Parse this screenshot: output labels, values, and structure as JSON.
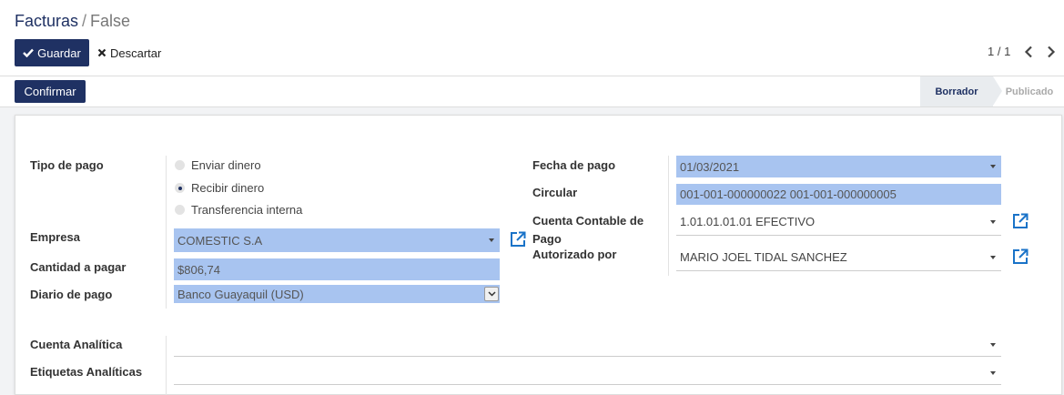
{
  "breadcrumb": {
    "parent": "Facturas",
    "separator": "/",
    "current": "False"
  },
  "toolbar": {
    "save_label": "Guardar",
    "discard_label": "Descartar"
  },
  "pager": {
    "value": "1 / 1"
  },
  "statusbar": {
    "confirm_label": "Confirmar",
    "stages": [
      "Borrador",
      "Publicado"
    ],
    "active_stage": "Borrador"
  },
  "form": {
    "payment_type_label": "Tipo de pago",
    "payment_type_options": [
      "Enviar dinero",
      "Recibir dinero",
      "Transferencia interna"
    ],
    "payment_type_selected": "Recibir dinero",
    "partner_label": "Empresa",
    "partner_value": "COMESTIC S.A",
    "amount_label": "Cantidad a pagar",
    "amount_value": "$806,74",
    "journal_label": "Diario de pago",
    "journal_value": "Banco Guayaquil (USD)",
    "date_label": "Fecha de pago",
    "date_value": "01/03/2021",
    "circular_label": "Circular",
    "circular_value": "001-001-000000022 001-001-000000005",
    "account_label_line1": "Cuenta Contable de",
    "account_label_line2": "Pago",
    "account_value": "1.01.01.01.01 EFECTIVO",
    "authorized_label": "Autorizado por",
    "authorized_value": "MARIO JOEL TIDAL SANCHEZ",
    "analytic_account_label": "Cuenta Analítica",
    "analytic_account_value": "",
    "analytic_tags_label": "Etiquetas Analíticas",
    "analytic_tags_value": ""
  },
  "colors": {
    "primary": "#1f3163",
    "highlight": "#a8c4f0",
    "link": "#1a73c8"
  }
}
